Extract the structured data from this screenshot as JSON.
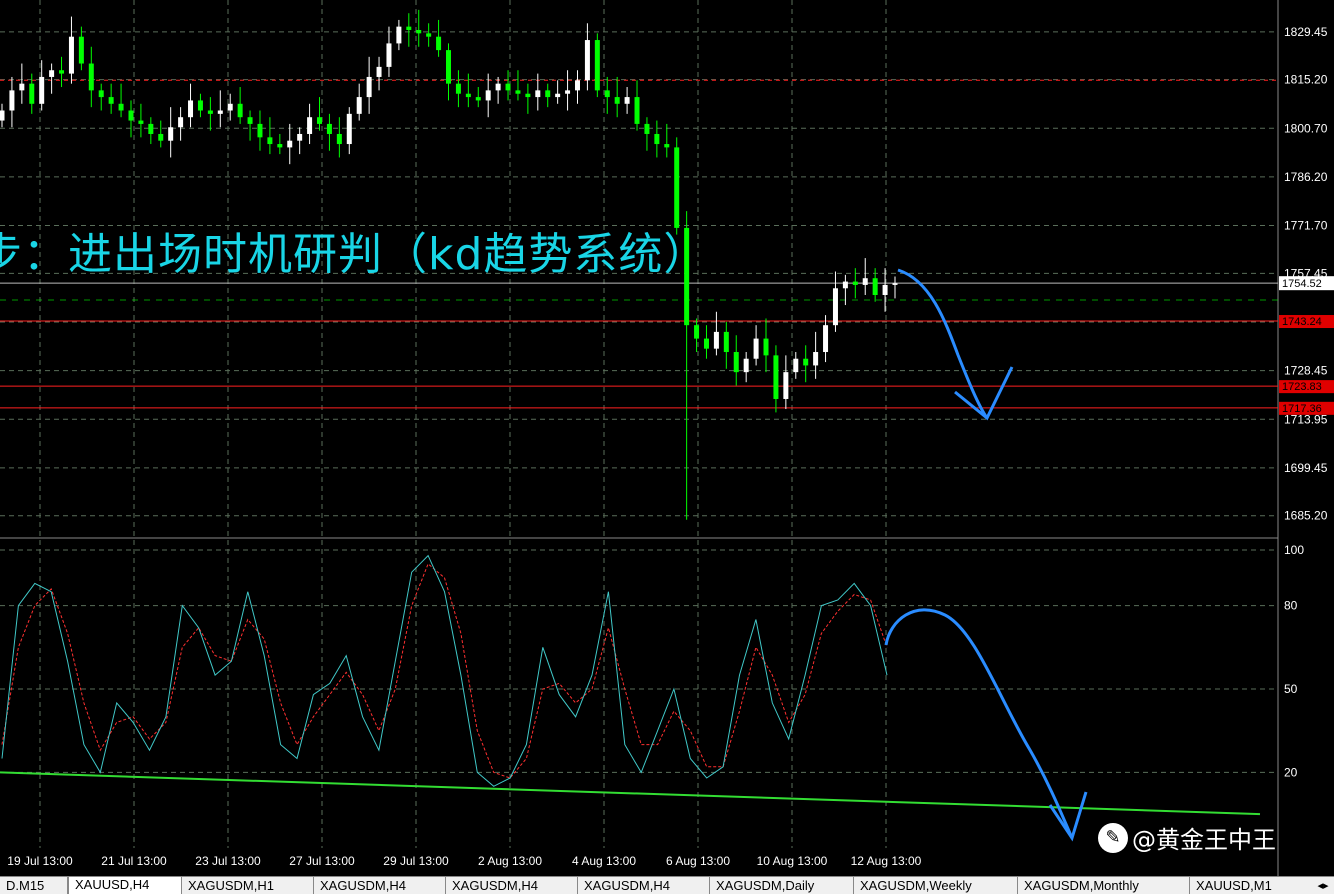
{
  "overlay_text": "步：进出场时机研判（kd趋势系统）",
  "watermark": {
    "icon": "weibo-like-logo",
    "text": "@黄金王中王"
  },
  "tabs": [
    {
      "label": "D.M15",
      "active": false
    },
    {
      "label": "XAUUSD,H4",
      "active": true
    },
    {
      "label": "XAGUSDM,H1",
      "active": false
    },
    {
      "label": "XAGUSDM,H4",
      "active": false
    },
    {
      "label": "XAGUSDM,H4",
      "active": false
    },
    {
      "label": "XAGUSDM,H4",
      "active": false
    },
    {
      "label": "XAGUSDM,Daily",
      "active": false
    },
    {
      "label": "XAGUSDM,Weekly",
      "active": false
    },
    {
      "label": "XAGUSDM,Monthly",
      "active": false
    },
    {
      "label": "XAUUSD,M1",
      "active": false
    }
  ],
  "colors": {
    "background": "#000000",
    "grid": "#5a6e5a",
    "bull": "#ffffff",
    "bear": "#00ff00",
    "hline": "#ff2020",
    "k_line": "#40c8c8",
    "d_line": "#ff3030",
    "trendline": "#33dd33",
    "annotation": "#2a8cff"
  },
  "chart_data": [
    {
      "type": "candlestick",
      "title": "",
      "symbol": "XAUUSD",
      "timeframe": "H4",
      "ylim": [
        1679.45,
        1837.45
      ],
      "y_ticks": [
        1829.45,
        1815.2,
        1800.7,
        1786.2,
        1771.7,
        1757.45,
        1742.95,
        1728.45,
        1713.95,
        1699.45,
        1685.2
      ],
      "x_tick_labels": [
        "19 Jul 13:00",
        "21 Jul 13:00",
        "23 Jul 13:00",
        "27 Jul 13:00",
        "29 Jul 13:00",
        "2 Aug 13:00",
        "4 Aug 13:00",
        "6 Aug 13:00",
        "10 Aug 13:00",
        "12 Aug 13:00"
      ],
      "current_price": "1754.52",
      "current_price_value": 1754.52,
      "horizontal_lines": [
        {
          "label": "1743.24",
          "value": 1743.24
        },
        {
          "label": "1723.83",
          "value": 1723.83
        },
        {
          "label": "1717.36",
          "value": 1717.36
        }
      ],
      "extra_hline_value": 1815.0,
      "closes": [
        1806,
        1812,
        1814,
        1808,
        1816,
        1818,
        1817,
        1828,
        1820,
        1812,
        1810,
        1808,
        1806,
        1803,
        1802,
        1799,
        1797,
        1801,
        1804,
        1809,
        1806,
        1805,
        1806,
        1808,
        1804,
        1802,
        1798,
        1796,
        1795,
        1797,
        1799,
        1804,
        1802,
        1799,
        1796,
        1805,
        1810,
        1816,
        1819,
        1826,
        1831,
        1830,
        1829,
        1828,
        1824,
        1814,
        1811,
        1810,
        1809,
        1812,
        1814,
        1812,
        1811,
        1810,
        1812,
        1810,
        1811,
        1812,
        1815,
        1827,
        1812,
        1810,
        1808,
        1810,
        1802,
        1799,
        1796,
        1795,
        1771,
        1742,
        1738,
        1735,
        1740,
        1734,
        1728,
        1732,
        1738,
        1733,
        1720,
        1728,
        1732,
        1730,
        1734,
        1742,
        1753,
        1755,
        1754,
        1756,
        1751,
        1754,
        1754.5
      ]
    },
    {
      "type": "line",
      "title": "",
      "ylim": [
        0,
        100
      ],
      "y_ticks": [
        100,
        80,
        50,
        20
      ],
      "K": [
        25,
        80,
        88,
        85,
        60,
        30,
        20,
        45,
        38,
        28,
        40,
        80,
        72,
        55,
        60,
        85,
        62,
        30,
        25,
        48,
        52,
        62,
        40,
        28,
        60,
        92,
        98,
        85,
        55,
        20,
        15,
        18,
        30,
        65,
        48,
        40,
        55,
        85,
        30,
        20,
        35,
        50,
        25,
        18,
        22,
        55,
        75,
        45,
        32,
        55,
        80,
        82,
        88,
        80,
        55
      ],
      "D": [
        30,
        65,
        80,
        86,
        70,
        45,
        28,
        38,
        40,
        32,
        38,
        65,
        72,
        62,
        60,
        75,
        68,
        45,
        30,
        40,
        48,
        56,
        48,
        35,
        50,
        80,
        95,
        90,
        70,
        35,
        20,
        18,
        25,
        50,
        52,
        45,
        50,
        72,
        50,
        30,
        30,
        42,
        35,
        22,
        22,
        42,
        65,
        55,
        38,
        48,
        70,
        78,
        84,
        82,
        65
      ],
      "trendline_start": 20,
      "trendline_end": 5
    }
  ]
}
